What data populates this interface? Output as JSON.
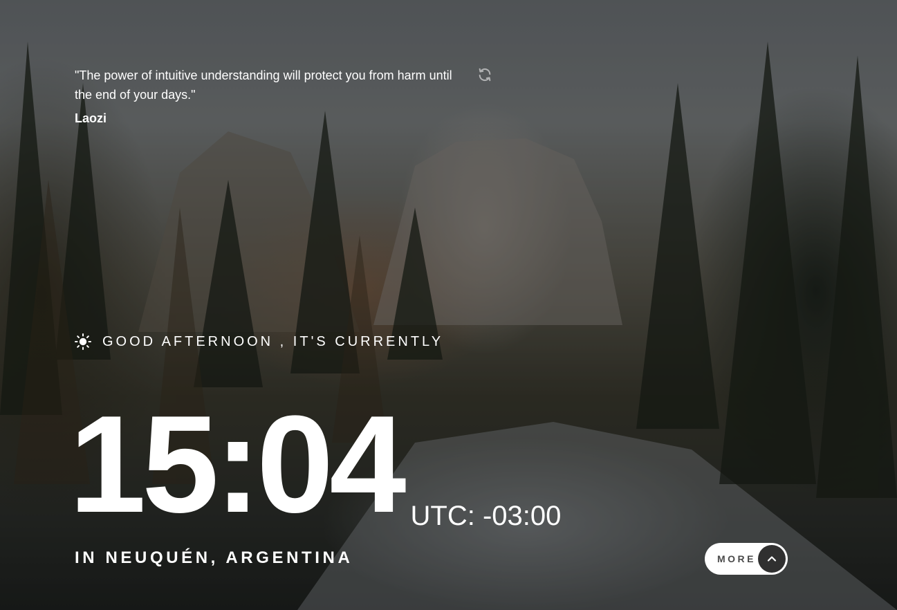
{
  "quote": {
    "text": "\"The power of intuitive understanding will protect you from harm until the end of your days.\"",
    "author": "Laozi",
    "refresh_icon": "refresh-icon"
  },
  "greeting": {
    "icon": "sun-icon",
    "text": "GOOD AFTERNOON , IT'S CURRENTLY"
  },
  "clock": {
    "time": "15:04",
    "timezone": "UTC: -03:00"
  },
  "location": {
    "text": "IN NEUQUÉN, ARGENTINA"
  },
  "more_button": {
    "label": "MORE",
    "icon": "chevron-up-icon"
  },
  "colors": {
    "text": "#ffffff",
    "button_bg": "#ffffff",
    "button_text": "#4a4a4a",
    "chevron_bg": "#303030"
  }
}
